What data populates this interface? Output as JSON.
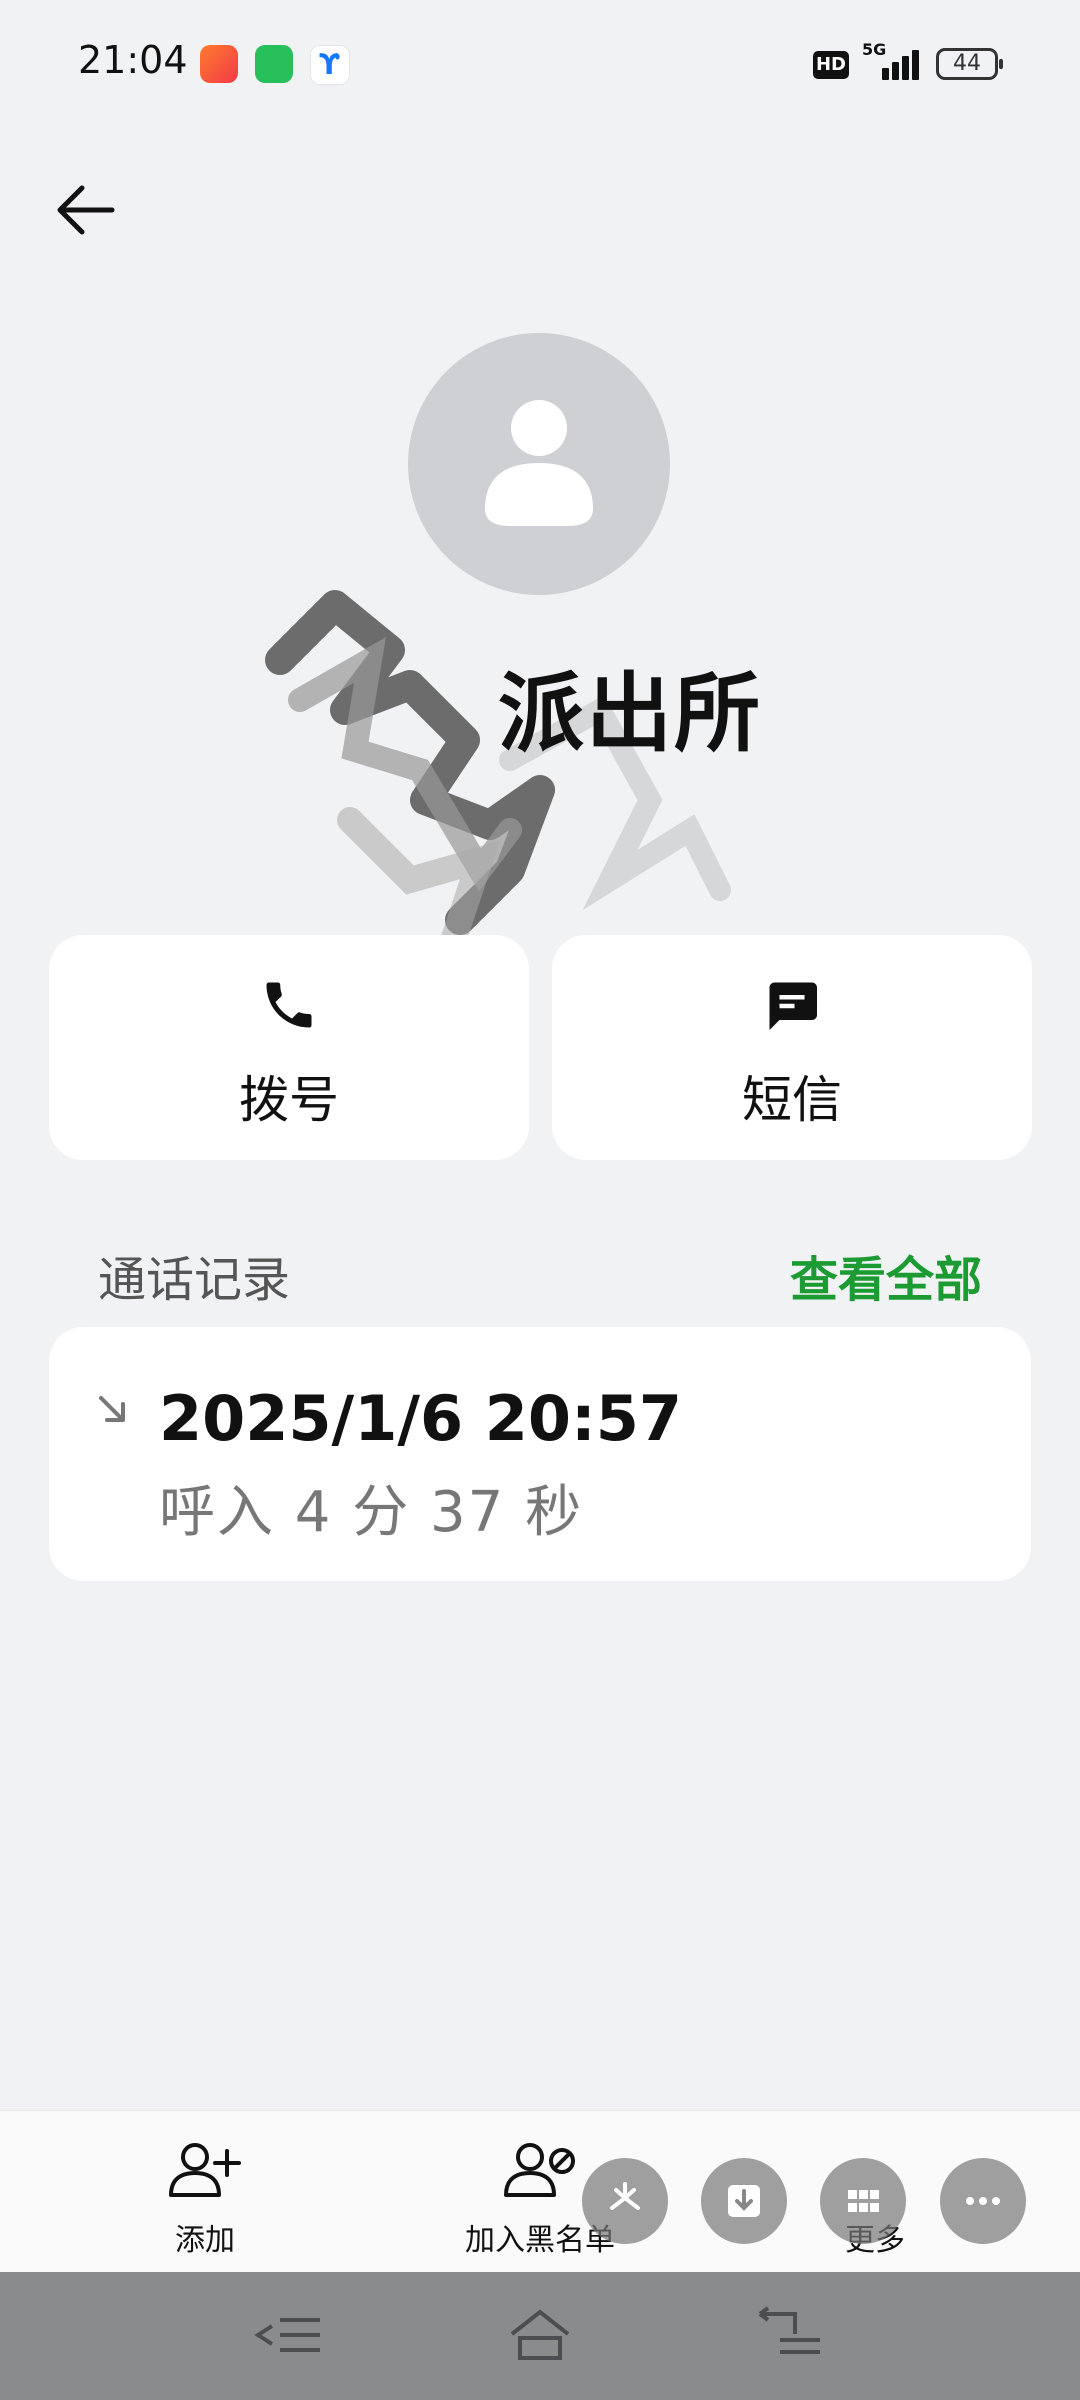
{
  "status": {
    "time": "21:04",
    "hd": "HD",
    "network": "5G",
    "battery": "44"
  },
  "contact": {
    "name": "派出所"
  },
  "actions": {
    "dial_label": "拨号",
    "sms_label": "短信"
  },
  "call_log": {
    "title": "通话记录",
    "view_all": "查看全部",
    "entries": [
      {
        "datetime": "2025/1/6 20:57",
        "detail": "呼入  4 分 37 秒",
        "direction": "incoming"
      }
    ]
  },
  "bottom_bar": {
    "add": "添加",
    "blacklist": "加入黑名单",
    "more": "更多"
  },
  "icons": {
    "back": "arrow-left-icon",
    "dial": "phone-icon",
    "sms": "message-icon",
    "incoming": "incoming-call-icon",
    "add": "add-person-icon",
    "blacklist": "block-person-icon",
    "more": "more-icon"
  },
  "colors": {
    "accent": "#1c9b33",
    "background": "#f1f2f4",
    "card": "#ffffff"
  }
}
